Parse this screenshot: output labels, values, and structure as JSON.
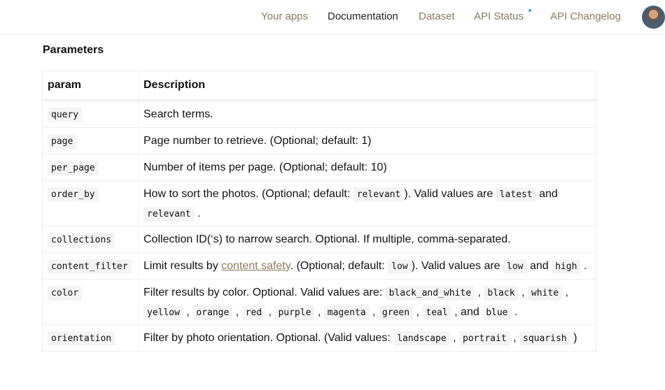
{
  "nav": {
    "items": [
      "Your apps",
      "Documentation",
      "Dataset",
      "API Status",
      "API Changelog"
    ]
  },
  "section_title": "Parameters",
  "table": {
    "headers": [
      "param",
      "Description"
    ],
    "rows": [
      {
        "param": "query",
        "desc": [
          "Search terms."
        ]
      },
      {
        "param": "page",
        "desc": [
          "Page number to retrieve. (Optional; default: 1)"
        ]
      },
      {
        "param": "per_page",
        "desc": [
          "Number of items per page. (Optional; default: 10)"
        ]
      },
      {
        "param": "order_by",
        "desc": [
          "How to sort the photos. (Optional; default: ",
          "relevant",
          "). Valid values are ",
          "latest",
          " and ",
          "relevant",
          " ."
        ]
      },
      {
        "param": "collections",
        "desc": [
          "Collection ID(‘s) to narrow search. Optional. If multiple, comma-separated."
        ]
      },
      {
        "param": "content_filter",
        "desc": [
          "Limit results by ",
          "content safety",
          ". (Optional; default: ",
          "low",
          "). Valid values are ",
          "low",
          " and ",
          "high",
          " ."
        ]
      },
      {
        "param": "color",
        "desc": [
          "Filter results by color. Optional. Valid values are: ",
          "black_and_white",
          " , ",
          "black",
          " , ",
          "white",
          " , ",
          "yellow",
          " , ",
          "orange",
          " , ",
          "red",
          " , ",
          "purple",
          " , ",
          "magenta",
          " , ",
          "green",
          " , ",
          "teal",
          " , and ",
          "blue",
          " ."
        ]
      },
      {
        "param": "orientation",
        "desc": [
          "Filter by photo orientation. Optional. (Valid values: ",
          "landscape",
          " , ",
          "portrait",
          " , ",
          "squarish",
          " )"
        ]
      }
    ]
  }
}
